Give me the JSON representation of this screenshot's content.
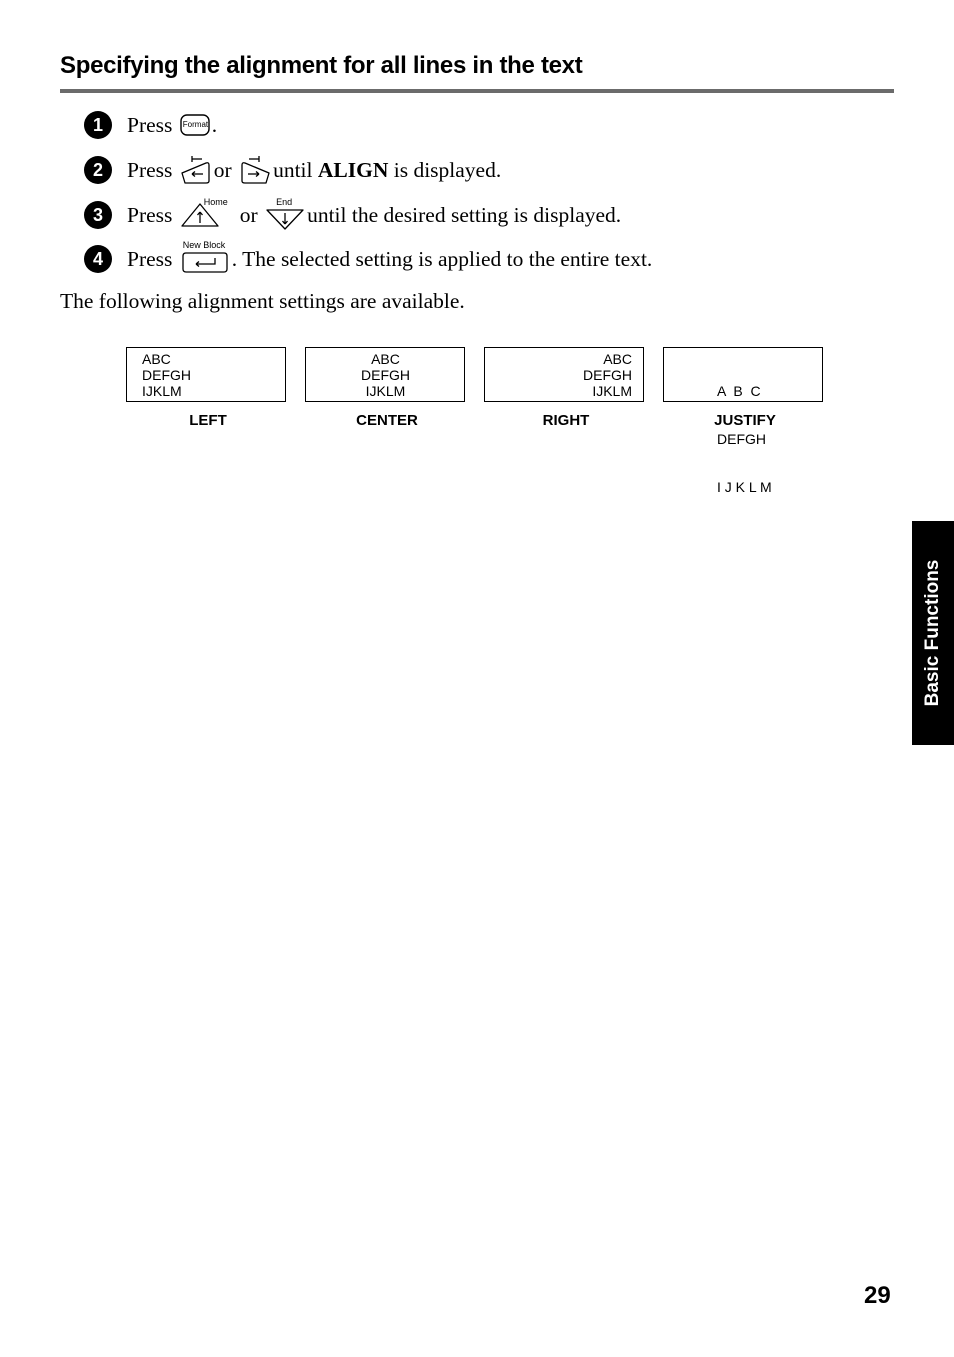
{
  "heading": "Specifying the alignment for all lines in the text",
  "steps": [
    {
      "num": "1",
      "pre": "Press",
      "post": "."
    },
    {
      "num": "2",
      "pre": "Press",
      "mid": "or",
      "post_normal": "until",
      "bold": "ALIGN",
      "post": "is displayed."
    },
    {
      "num": "3",
      "pre": "Press",
      "mid": "or",
      "post": "until the desired setting is displayed."
    },
    {
      "num": "4",
      "pre": "Press",
      "post": ". The selected setting is applied to the entire text."
    }
  ],
  "keys": {
    "format": "Format",
    "home": "Home",
    "end": "End",
    "new_block": "New Block"
  },
  "intro": "The following alignment settings are available.",
  "alignments": [
    {
      "label": "LEFT",
      "lines": [
        "ABC",
        "DEFGH",
        "IJKLM"
      ]
    },
    {
      "label": "CENTER",
      "lines": [
        "ABC",
        "DEFGH",
        "IJKLM"
      ]
    },
    {
      "label": "RIGHT",
      "lines": [
        "ABC",
        "DEFGH",
        "IJKLM"
      ]
    },
    {
      "label": "JUSTIFY",
      "lines": [
        "A  B  C",
        "DEFGH",
        "I J K L M"
      ]
    }
  ],
  "side_tab": "Basic Functions",
  "page_number": "29"
}
